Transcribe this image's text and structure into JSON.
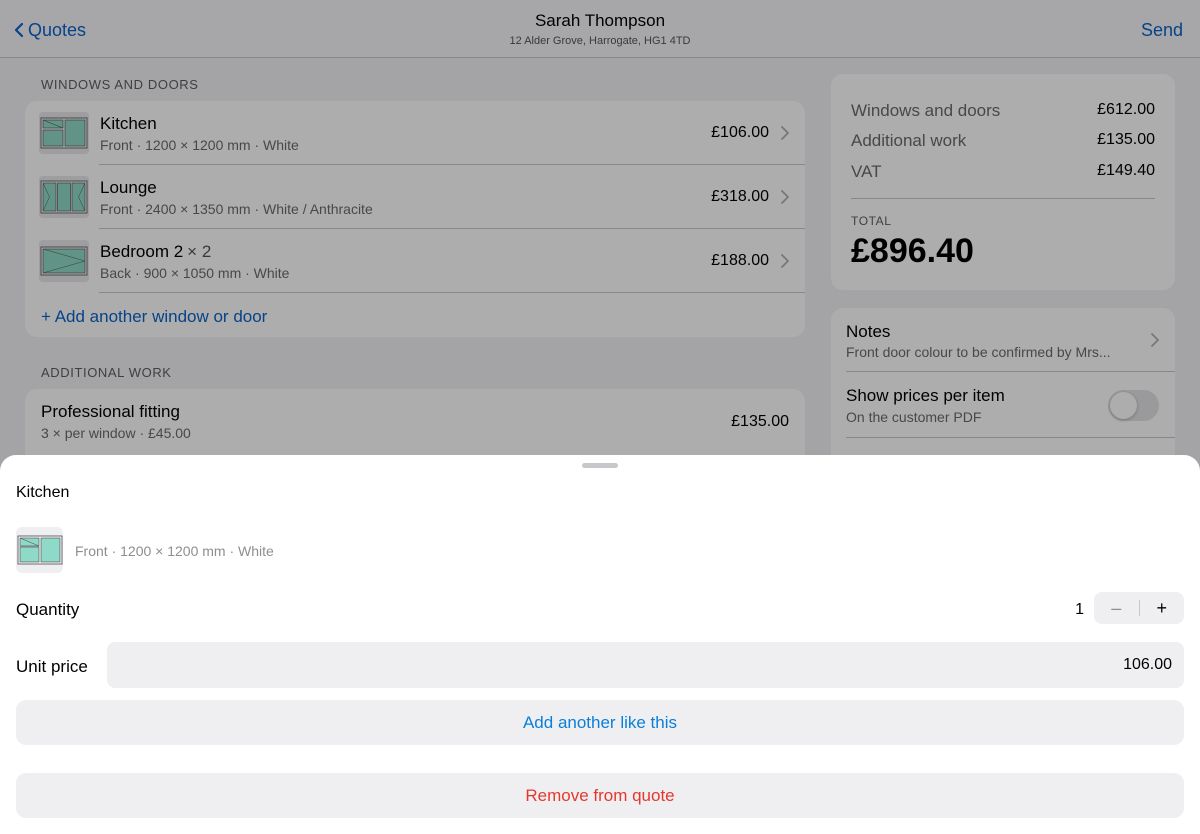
{
  "navbar": {
    "back_label": "Quotes",
    "title": "Sarah Thompson",
    "subtitle": "12 Alder Grove, Harrogate, HG1 4TD",
    "send_label": "Send"
  },
  "windows_section": {
    "header": "WINDOWS AND DOORS",
    "items": [
      {
        "name": "Kitchen",
        "qty_text": "",
        "desc": "Front · 1200 × 1200 mm · White",
        "price": "£106.00"
      },
      {
        "name": "Lounge",
        "qty_text": "",
        "desc": "Front · 2400 × 1350 mm · White / Anthracite",
        "price": "£318.00"
      },
      {
        "name": "Bedroom 2",
        "qty_text": "× 2",
        "desc": "Back · 900 × 1050 mm · White",
        "price": "£188.00"
      }
    ],
    "add_link": "+ Add another window or door"
  },
  "additional_section": {
    "header": "ADDITIONAL WORK",
    "items": [
      {
        "name": "Professional fitting",
        "desc": "3 × per window · £45.00",
        "price": "£135.00"
      }
    ]
  },
  "summary": {
    "rows": [
      {
        "label": "Windows and doors",
        "value": "£612.00"
      },
      {
        "label": "Additional work",
        "value": "£135.00"
      },
      {
        "label": "VAT",
        "value": "£149.40"
      }
    ],
    "total_label": "TOTAL",
    "total_value": "£896.40"
  },
  "options": {
    "notes_title": "Notes",
    "notes_preview": "Front door colour to be confirmed by Mrs...",
    "show_prices_title": "Show prices per item",
    "show_prices_subtitle": "On the customer PDF",
    "show_prices_enabled": false
  },
  "sheet": {
    "title": "Kitchen",
    "desc": "Front · 1200 × 1200 mm · White",
    "quantity_label": "Quantity",
    "quantity_value": "1",
    "minus_label": "–",
    "plus_label": "+",
    "unit_price_label": "Unit price",
    "unit_price_value": "106.00",
    "add_another_label": "Add another like this",
    "remove_label": "Remove from quote"
  },
  "colors": {
    "accent": "#0a63c9",
    "destructive": "#e5382d",
    "glass": "#8fd9c8"
  }
}
